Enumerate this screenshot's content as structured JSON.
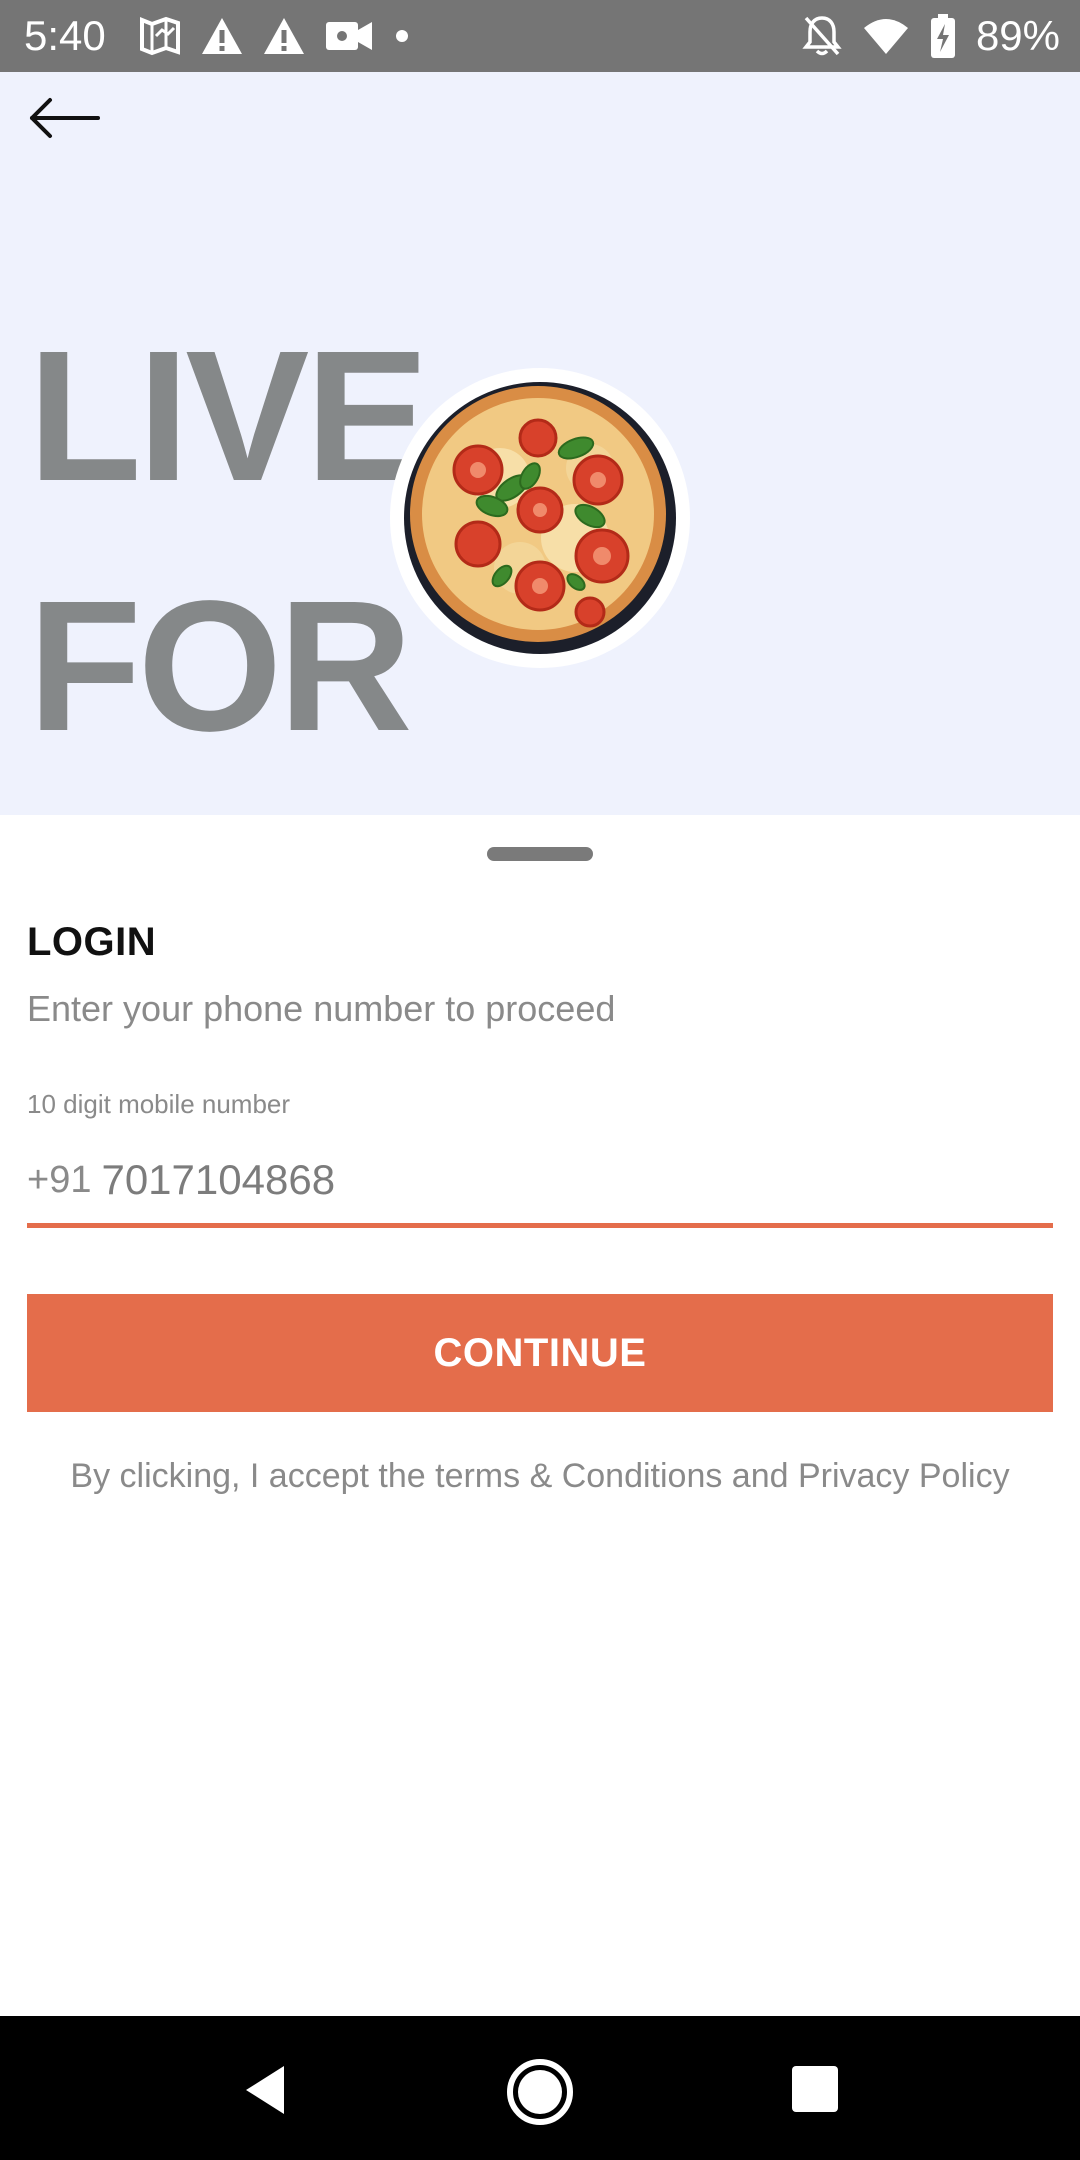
{
  "status_bar": {
    "time": "5:40",
    "battery": "89%",
    "left_icons": [
      "map-icon",
      "warning-icon",
      "warning-icon",
      "video-camera-icon",
      "dot-icon"
    ],
    "right_icons": [
      "bell-off-icon",
      "wifi-icon",
      "battery-charging-icon"
    ]
  },
  "hero": {
    "line1": "LIVE",
    "line2": "FOR",
    "background_color": "#eff2fd",
    "image": "pizza-image"
  },
  "login": {
    "title": "LOGIN",
    "subtitle": "Enter your phone number to proceed",
    "field_label": "10 digit mobile number",
    "country_code": "+91",
    "phone_value": "7017104868",
    "continue_label": "CONTINUE",
    "terms_text": "By clicking, I accept the terms & Conditions and Privacy Policy",
    "accent_color": "#e46d4b"
  },
  "nav_bar": {
    "icons": [
      "back-triangle-icon",
      "home-circle-icon",
      "recents-square-icon"
    ]
  }
}
